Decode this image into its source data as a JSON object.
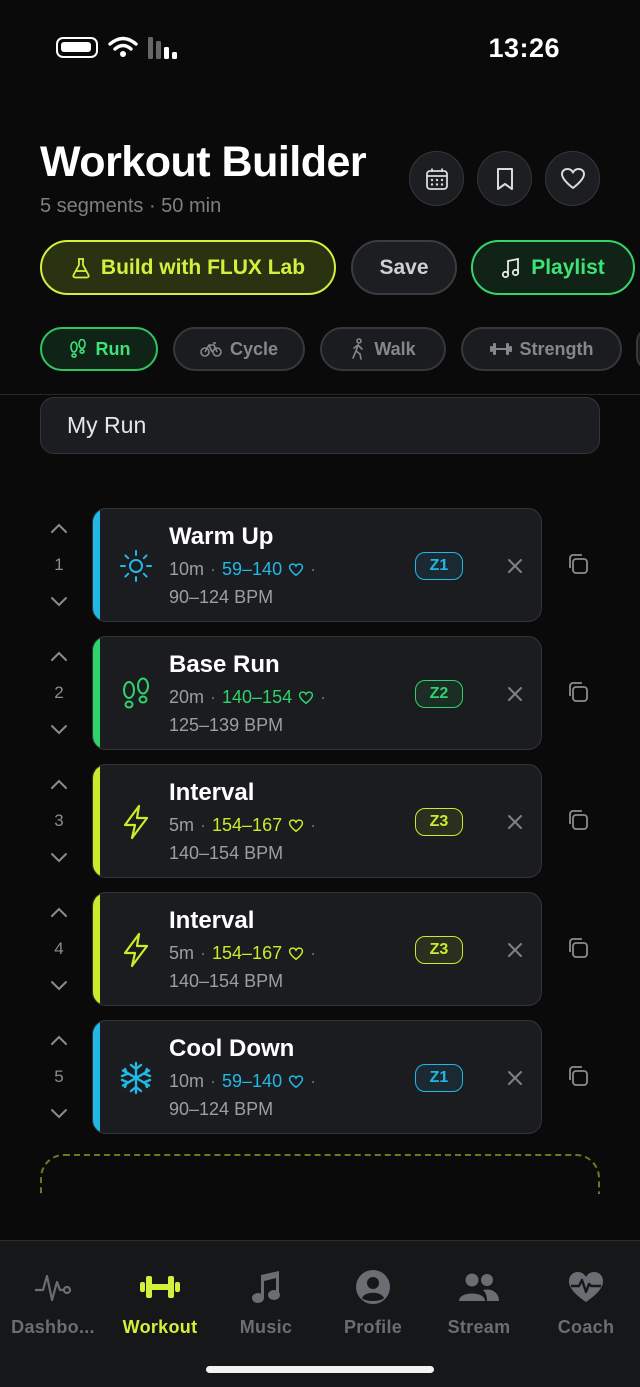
{
  "status_bar": {
    "time": "13:26"
  },
  "header": {
    "title": "Workout Builder",
    "subtitle": "5 segments · 50 min",
    "icons": [
      "calendar-icon",
      "bookmark-icon",
      "heart-icon"
    ]
  },
  "actions": {
    "flux_label": "Build with FLUX Lab",
    "save_label": "Save",
    "playlist_label": "Playlist"
  },
  "activity_types": [
    {
      "label": "Run",
      "icon": "footprints-icon",
      "selected": true
    },
    {
      "label": "Cycle",
      "icon": "bicycle-icon",
      "selected": false
    },
    {
      "label": "Walk",
      "icon": "walking-icon",
      "selected": false
    },
    {
      "label": "Strength",
      "icon": "dumbbell-icon",
      "selected": false
    }
  ],
  "workout_name": {
    "value": "My Run"
  },
  "segments": [
    {
      "index": "1",
      "name": "Warm Up",
      "duration": "10m",
      "hr_range": "59–140",
      "bpm": "90–124 BPM",
      "zone": "Z1",
      "icon": "sun-icon",
      "color": "#22b8e6"
    },
    {
      "index": "2",
      "name": "Base Run",
      "duration": "20m",
      "hr_range": "140–154",
      "bpm": "125–139 BPM",
      "zone": "Z2",
      "icon": "footprints-icon",
      "color": "#2fd36b"
    },
    {
      "index": "3",
      "name": "Interval",
      "duration": "5m",
      "hr_range": "154–167",
      "bpm": "140–154 BPM",
      "zone": "Z3",
      "icon": "lightning-icon",
      "color": "#c8ec2a"
    },
    {
      "index": "4",
      "name": "Interval",
      "duration": "5m",
      "hr_range": "154–167",
      "bpm": "140–154 BPM",
      "zone": "Z3",
      "icon": "lightning-icon",
      "color": "#c8ec2a"
    },
    {
      "index": "5",
      "name": "Cool Down",
      "duration": "10m",
      "hr_range": "59–140",
      "bpm": "90–124 BPM",
      "zone": "Z1",
      "icon": "snowflake-icon",
      "color": "#22b8e6"
    }
  ],
  "tab_bar": {
    "active": "Workout",
    "tabs": [
      {
        "label": "Dashbo...",
        "icon": "pulse-icon"
      },
      {
        "label": "Workout",
        "icon": "dumbbell-icon"
      },
      {
        "label": "Music",
        "icon": "music-note-icon"
      },
      {
        "label": "Profile",
        "icon": "person-icon"
      },
      {
        "label": "Stream",
        "icon": "people-icon"
      },
      {
        "label": "Coach",
        "icon": "heart-pulse-icon"
      }
    ]
  },
  "colors": {
    "accent_lime": "#d4f03c",
    "accent_green": "#3ee276",
    "zone1": "#22b8e6",
    "zone2": "#2fd36b",
    "zone3": "#c8ec2a"
  }
}
